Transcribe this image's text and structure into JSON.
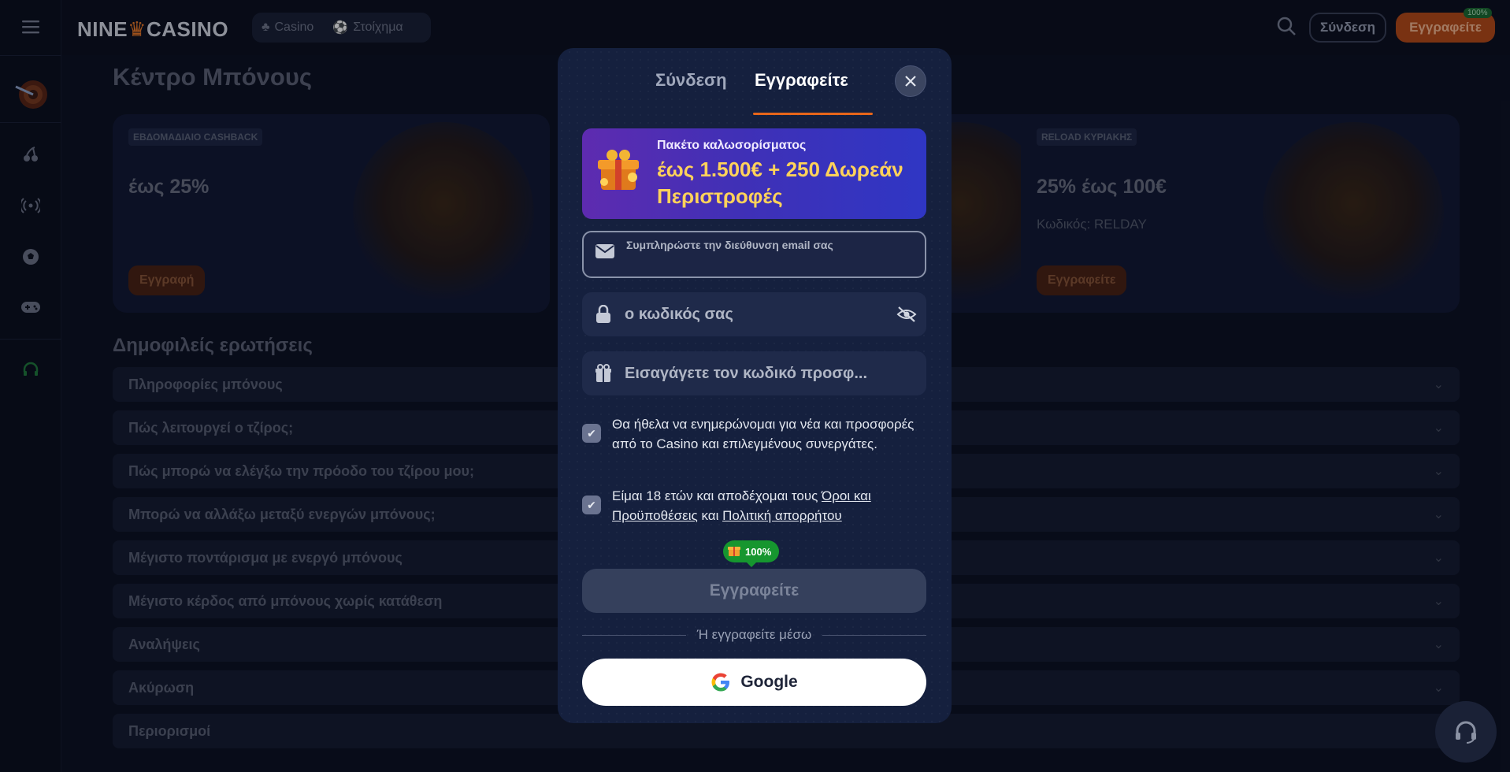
{
  "header": {
    "logo_left": "NINE",
    "logo_right": "CASINO",
    "nav": [
      {
        "label": "Casino"
      },
      {
        "label": "Στοίχημα"
      }
    ],
    "login_label": "Σύνδεση",
    "signup_label": "Εγγραφείτε",
    "signup_badge": "100%"
  },
  "page": {
    "bonus_title": "Κέντρο Μπόνους",
    "cards": [
      {
        "tag": "ΕΒΔΟΜΑΔΙΑΙΟ CASHBACK",
        "value": "έως 25%",
        "code": "",
        "cta": "Εγγραφή"
      },
      {
        "tag": "RELOAD ΚΥΡΙΑΚΗΣ",
        "value": "25% έως 100€",
        "code": "Κωδικός: RELDAY",
        "cta": "Εγγραφείτε"
      }
    ],
    "faq_title": "Δημοφιλείς ερωτήσεις",
    "faq": [
      "Πληροφορίες μπόνους",
      "Πώς λειτουργεί ο τζίρος;",
      "Πώς μπορώ να ελέγξω την πρόοδο του τζίρου μου;",
      "Μπορώ να αλλάξω μεταξύ ενεργών μπόνους;",
      "Μέγιστο ποντάρισμα με ενεργό μπόνους",
      "Μέγιστο κέρδος από μπόνους χωρίς κατάθεση",
      "Αναλήψεις",
      "Ακύρωση",
      "Περιορισμοί"
    ]
  },
  "modal": {
    "tab_login": "Σύνδεση",
    "tab_register": "Εγγραφείτε",
    "promo_title": "Πακέτο καλωσορίσματος",
    "promo_amount": "έως 1.500€ + 250 Δωρεάν Περιστροφές",
    "email_placeholder": "Συμπληρώστε την διεύθυνση email σας",
    "password_placeholder": "ο κωδικός σας",
    "promo_code_placeholder": "Εισαγάγετε τον κωδικό προσφ...",
    "newsletter_text": "Θα ήθελα να ενημερώνομαι για νέα και προσφορές από το Casino και επιλεγμένους συνεργάτες.",
    "terms_prefix": "Είμαι 18 ετών και αποδέχομαι τους ",
    "terms_link": "Όροι και Προϋποθέσεις",
    "terms_and": " και ",
    "privacy_link": "Πολιτική απορρήτου",
    "progress_badge": "100%",
    "submit_label": "Εγγραφείτε",
    "divider_text": "Ή εγγραφείτε μέσω",
    "google_label": "Google"
  },
  "colors": {
    "accent": "#e8651a",
    "success": "#16962f",
    "promo_gold": "#ffd25a"
  }
}
